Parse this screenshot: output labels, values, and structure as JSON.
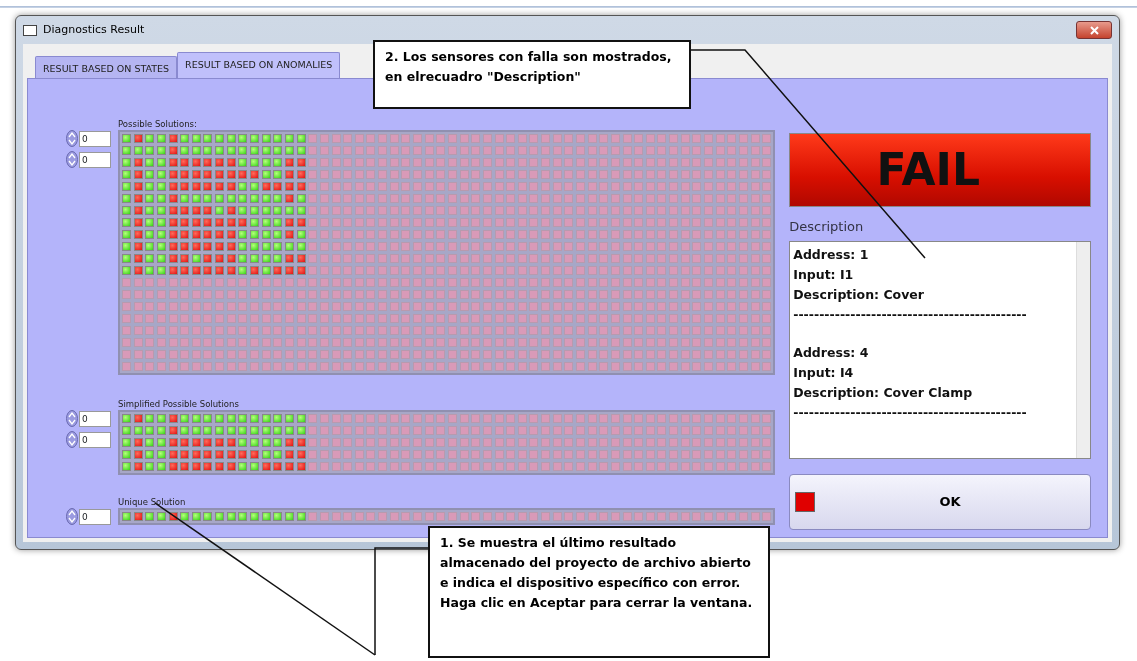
{
  "window": {
    "title": "Diagnostics Result"
  },
  "tabs": [
    {
      "label": "RESULT BASED ON STATES",
      "selected": false
    },
    {
      "label": "RESULT BASED ON ANOMALIES",
      "selected": true
    }
  ],
  "possible_solutions": {
    "label": "Possible Solutions:",
    "indices": [
      "0",
      "0"
    ],
    "rows": [
      [
        false,
        true,
        false,
        false,
        true,
        false,
        false,
        false,
        false,
        false,
        false,
        false,
        false,
        false,
        false,
        false
      ],
      [
        false,
        false,
        false,
        false,
        true,
        false,
        false,
        false,
        false,
        false,
        false,
        false,
        false,
        false,
        false,
        false
      ],
      [
        false,
        true,
        false,
        false,
        true,
        true,
        true,
        true,
        true,
        true,
        false,
        false,
        false,
        false,
        true,
        true
      ],
      [
        false,
        true,
        false,
        false,
        true,
        true,
        true,
        true,
        true,
        true,
        true,
        true,
        false,
        false,
        true,
        true
      ],
      [
        false,
        true,
        false,
        false,
        true,
        true,
        true,
        true,
        true,
        true,
        false,
        false,
        true,
        true,
        true,
        true
      ],
      [
        false,
        true,
        false,
        false,
        true,
        false,
        false,
        false,
        false,
        false,
        false,
        false,
        false,
        false,
        true,
        false
      ],
      [
        false,
        true,
        false,
        false,
        true,
        true,
        true,
        true,
        false,
        true,
        false,
        false,
        false,
        false,
        false,
        false
      ],
      [
        false,
        true,
        false,
        false,
        true,
        true,
        true,
        true,
        true,
        true,
        true,
        false,
        false,
        false,
        true,
        true
      ],
      [
        false,
        true,
        false,
        false,
        true,
        true,
        true,
        true,
        true,
        true,
        false,
        false,
        false,
        false,
        true,
        false
      ],
      [
        false,
        true,
        false,
        false,
        true,
        true,
        true,
        true,
        true,
        true,
        false,
        false,
        false,
        false,
        false,
        false
      ],
      [
        false,
        true,
        false,
        false,
        true,
        true,
        false,
        true,
        true,
        true,
        false,
        false,
        false,
        false,
        true,
        true
      ],
      [
        false,
        true,
        false,
        false,
        true,
        true,
        true,
        true,
        true,
        true,
        false,
        true,
        false,
        true,
        true,
        true
      ]
    ]
  },
  "simplified_solutions": {
    "label": "Simplified Possible Solutions",
    "indices": [
      "0",
      "0"
    ],
    "rows": [
      [
        false,
        true,
        false,
        false,
        true,
        false,
        false,
        false,
        false,
        false,
        false,
        false,
        false,
        false,
        false,
        false
      ],
      [
        false,
        false,
        false,
        false,
        true,
        false,
        false,
        false,
        false,
        false,
        false,
        false,
        false,
        false,
        false,
        false
      ],
      [
        false,
        true,
        false,
        false,
        true,
        true,
        true,
        true,
        true,
        true,
        false,
        false,
        false,
        false,
        true,
        true
      ],
      [
        false,
        true,
        false,
        false,
        true,
        true,
        true,
        true,
        true,
        true,
        true,
        true,
        false,
        false,
        true,
        true
      ],
      [
        false,
        true,
        false,
        false,
        true,
        true,
        true,
        true,
        true,
        true,
        false,
        false,
        true,
        true,
        true,
        true
      ]
    ]
  },
  "unique_solution": {
    "label": "Unique Solution",
    "indices": [
      "0"
    ],
    "rows": [
      [
        false,
        true,
        false,
        false,
        true,
        false,
        false,
        false,
        false,
        false,
        false,
        false,
        false,
        false,
        false,
        false
      ]
    ]
  },
  "status_banner": {
    "label": "FAIL"
  },
  "description": {
    "label": "Description",
    "entries": [
      {
        "lines": [
          "Address: 1",
          "Input: I1",
          "Description: Cover"
        ],
        "separator": "---------------------------------------------"
      },
      {
        "lines": [
          "Address: 4",
          "Input: I4",
          "Description: Cover Clamp"
        ],
        "separator": "---------------------------------------------"
      }
    ]
  },
  "ok_button": {
    "label": "OK",
    "indicator_on": true
  },
  "annotations": [
    {
      "text": "2. Los sensores con falla son mostrados, en elrecuadro \"Description\""
    },
    {
      "text": "1. Se muestra el último resultado almacenado del proyecto de archivo abierto e indica el dispositivo específico con error. Haga clic en Aceptar para cerrar la ventana."
    }
  ]
}
